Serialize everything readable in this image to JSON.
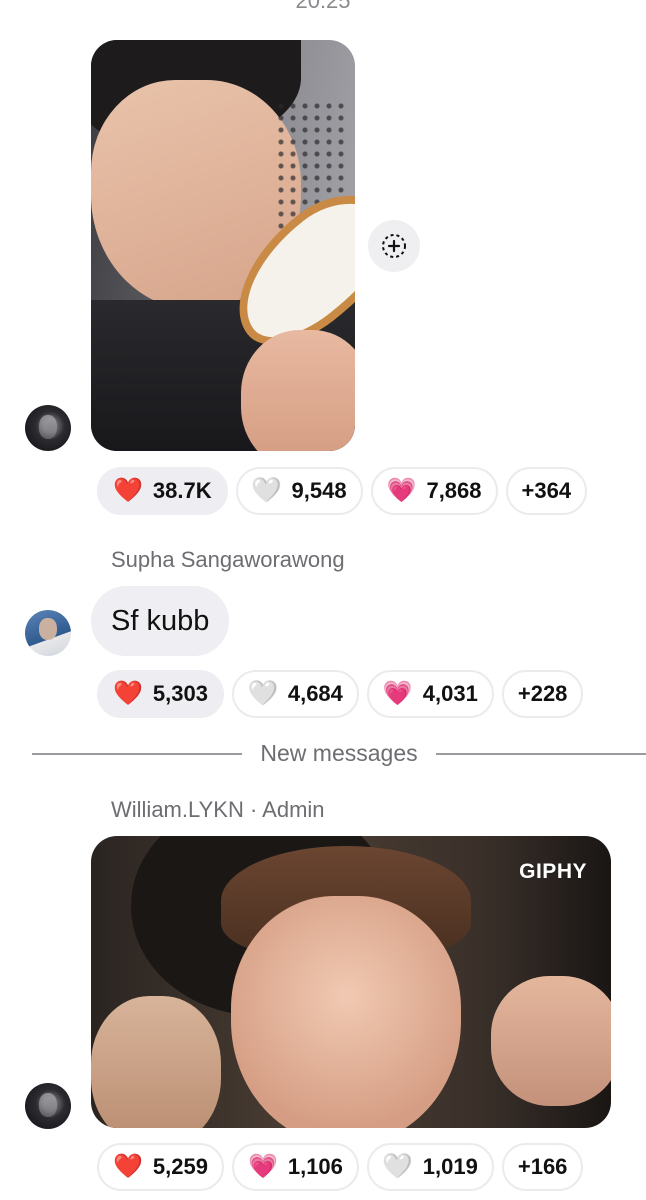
{
  "status": {
    "time": "20:25"
  },
  "messages": [
    {
      "type": "photo",
      "reactions": [
        {
          "emoji": "❤️",
          "icon": "red-heart-icon",
          "count": "38.7K"
        },
        {
          "emoji": "🤍",
          "icon": "white-heart-icon",
          "count": "9,548"
        },
        {
          "emoji": "💗",
          "icon": "pink-heart-icon",
          "count": "7,868"
        },
        {
          "emoji": "",
          "icon": "",
          "count": "+364"
        }
      ]
    },
    {
      "type": "text",
      "sender": "Supha Sangaworawong",
      "text": "Sf kubb",
      "reactions": [
        {
          "emoji": "❤️",
          "icon": "red-heart-icon",
          "count": "5,303"
        },
        {
          "emoji": "🤍",
          "icon": "white-heart-icon",
          "count": "4,684"
        },
        {
          "emoji": "💗",
          "icon": "pink-heart-icon",
          "count": "4,031"
        },
        {
          "emoji": "",
          "icon": "",
          "count": "+228"
        }
      ]
    },
    {
      "type": "gif",
      "sender": "William.LYKN · Admin",
      "gif_badge": "GIPHY",
      "reactions": [
        {
          "emoji": "❤️",
          "icon": "red-heart-icon",
          "count": "5,259"
        },
        {
          "emoji": "💗",
          "icon": "pink-heart-icon",
          "count": "1,106"
        },
        {
          "emoji": "🤍",
          "icon": "white-heart-icon",
          "count": "1,019"
        },
        {
          "emoji": "",
          "icon": "",
          "count": "+166"
        }
      ]
    }
  ],
  "divider": {
    "label": "New messages"
  },
  "colors": {
    "red_heart": "#e0242d",
    "pink_heart": "#ea4fa3",
    "muted_text": "#6d6d72",
    "bubble_bg": "#efeff3"
  }
}
